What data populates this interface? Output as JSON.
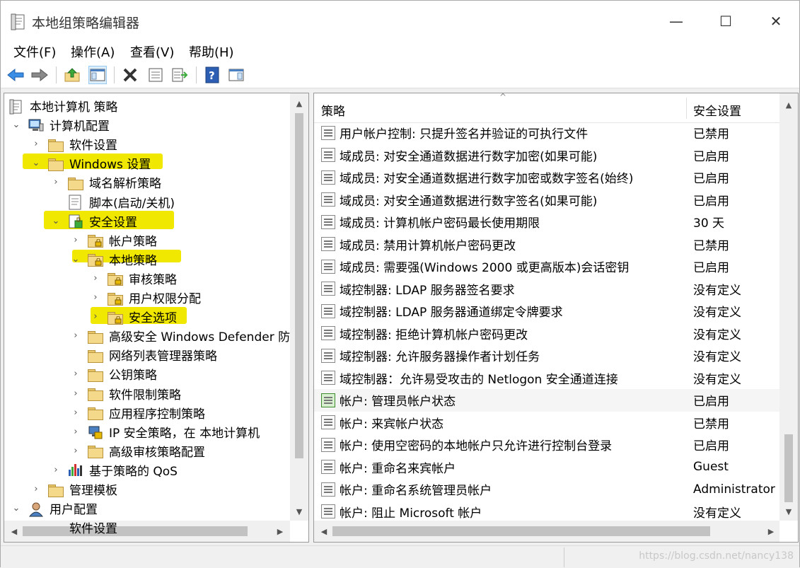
{
  "window": {
    "title": "本地组策略编辑器",
    "minimize": "—",
    "maximize": "☐",
    "close": "✕"
  },
  "menu": [
    "文件(F)",
    "操作(A)",
    "查看(V)",
    "帮助(H)"
  ],
  "toolbar": {
    "icons": [
      "back-icon",
      "forward-icon",
      "up-folder-icon",
      "show-hide-tree-icon",
      "delete-icon",
      "properties-icon",
      "export-icon",
      "help-icon",
      "show-hide-action-pane-icon"
    ]
  },
  "tree": {
    "items": [
      {
        "label": "本地计算机 策略",
        "chev": "",
        "icon": "policy-doc-icon"
      },
      {
        "label": "计算机配置",
        "chev": "⌄",
        "icon": "computer-icon"
      },
      {
        "label": "软件设置",
        "chev": "›",
        "icon": "folder-icon"
      },
      {
        "label": "Windows 设置",
        "chev": "⌄",
        "icon": "folder-icon"
      },
      {
        "label": "域名解析策略",
        "chev": "›",
        "icon": "folder-icon"
      },
      {
        "label": "脚本(启动/关机)",
        "chev": "",
        "icon": "script-icon"
      },
      {
        "label": "安全设置",
        "chev": "⌄",
        "icon": "security-icon"
      },
      {
        "label": "帐户策略",
        "chev": "›",
        "icon": "lock-folder-icon"
      },
      {
        "label": "本地策略",
        "chev": "⌄",
        "icon": "lock-folder-icon"
      },
      {
        "label": "审核策略",
        "chev": "›",
        "icon": "lock-folder-icon"
      },
      {
        "label": "用户权限分配",
        "chev": "›",
        "icon": "lock-folder-icon"
      },
      {
        "label": "安全选项",
        "chev": "›",
        "icon": "lock-folder-icon"
      },
      {
        "label": "高级安全 Windows Defender 防",
        "chev": "›",
        "icon": "folder-icon"
      },
      {
        "label": "网络列表管理器策略",
        "chev": "",
        "icon": "folder-icon"
      },
      {
        "label": "公钥策略",
        "chev": "›",
        "icon": "folder-icon"
      },
      {
        "label": "软件限制策略",
        "chev": "›",
        "icon": "folder-icon"
      },
      {
        "label": "应用程序控制策略",
        "chev": "›",
        "icon": "folder-icon"
      },
      {
        "label": "IP 安全策略，在 本地计算机",
        "chev": "›",
        "icon": "ip-security-icon"
      },
      {
        "label": "高级审核策略配置",
        "chev": "›",
        "icon": "folder-icon"
      },
      {
        "label": "基于策略的 QoS",
        "chev": "›",
        "icon": "qos-chart-icon"
      },
      {
        "label": "管理模板",
        "chev": "›",
        "icon": "folder-icon"
      },
      {
        "label": "用户配置",
        "chev": "⌄",
        "icon": "user-icon"
      },
      {
        "label": "软件设置",
        "chev": "",
        "icon": "folder-icon"
      }
    ]
  },
  "list": {
    "col_policy": "策略",
    "col_setting": "安全设置",
    "rows": [
      {
        "name": "用户帐户控制: 只提升签名并验证的可执行文件",
        "value": "已禁用"
      },
      {
        "name": "域成员: 对安全通道数据进行数字加密(如果可能)",
        "value": "已启用"
      },
      {
        "name": "域成员: 对安全通道数据进行数字加密或数字签名(始终)",
        "value": "已启用"
      },
      {
        "name": "域成员: 对安全通道数据进行数字签名(如果可能)",
        "value": "已启用"
      },
      {
        "name": "域成员: 计算机帐户密码最长使用期限",
        "value": "30 天"
      },
      {
        "name": "域成员: 禁用计算机帐户密码更改",
        "value": "已禁用"
      },
      {
        "name": "域成员: 需要强(Windows 2000 或更高版本)会话密钥",
        "value": "已启用"
      },
      {
        "name": "域控制器: LDAP 服务器签名要求",
        "value": "没有定义"
      },
      {
        "name": "域控制器: LDAP 服务器通道绑定令牌要求",
        "value": "没有定义"
      },
      {
        "name": "域控制器: 拒绝计算机帐户密码更改",
        "value": "没有定义"
      },
      {
        "name": "域控制器: 允许服务器操作者计划任务",
        "value": "没有定义"
      },
      {
        "name": "域控制器：允许易受攻击的 Netlogon 安全通道连接",
        "value": "没有定义"
      },
      {
        "name": "帐户: 管理员帐户状态",
        "value": "已启用"
      },
      {
        "name": "帐户: 来宾帐户状态",
        "value": "已禁用"
      },
      {
        "name": "帐户: 使用空密码的本地帐户只允许进行控制台登录",
        "value": "已启用"
      },
      {
        "name": "帐户: 重命名来宾帐户",
        "value": "Guest"
      },
      {
        "name": "帐户: 重命名系统管理员帐户",
        "value": "Administrator"
      },
      {
        "name": "帐户: 阻止 Microsoft 帐户",
        "value": "没有定义"
      }
    ]
  },
  "status": {
    "watermark": "https://blog.csdn.net/nancy138"
  },
  "colors": {
    "highlight": "#f0e800"
  }
}
